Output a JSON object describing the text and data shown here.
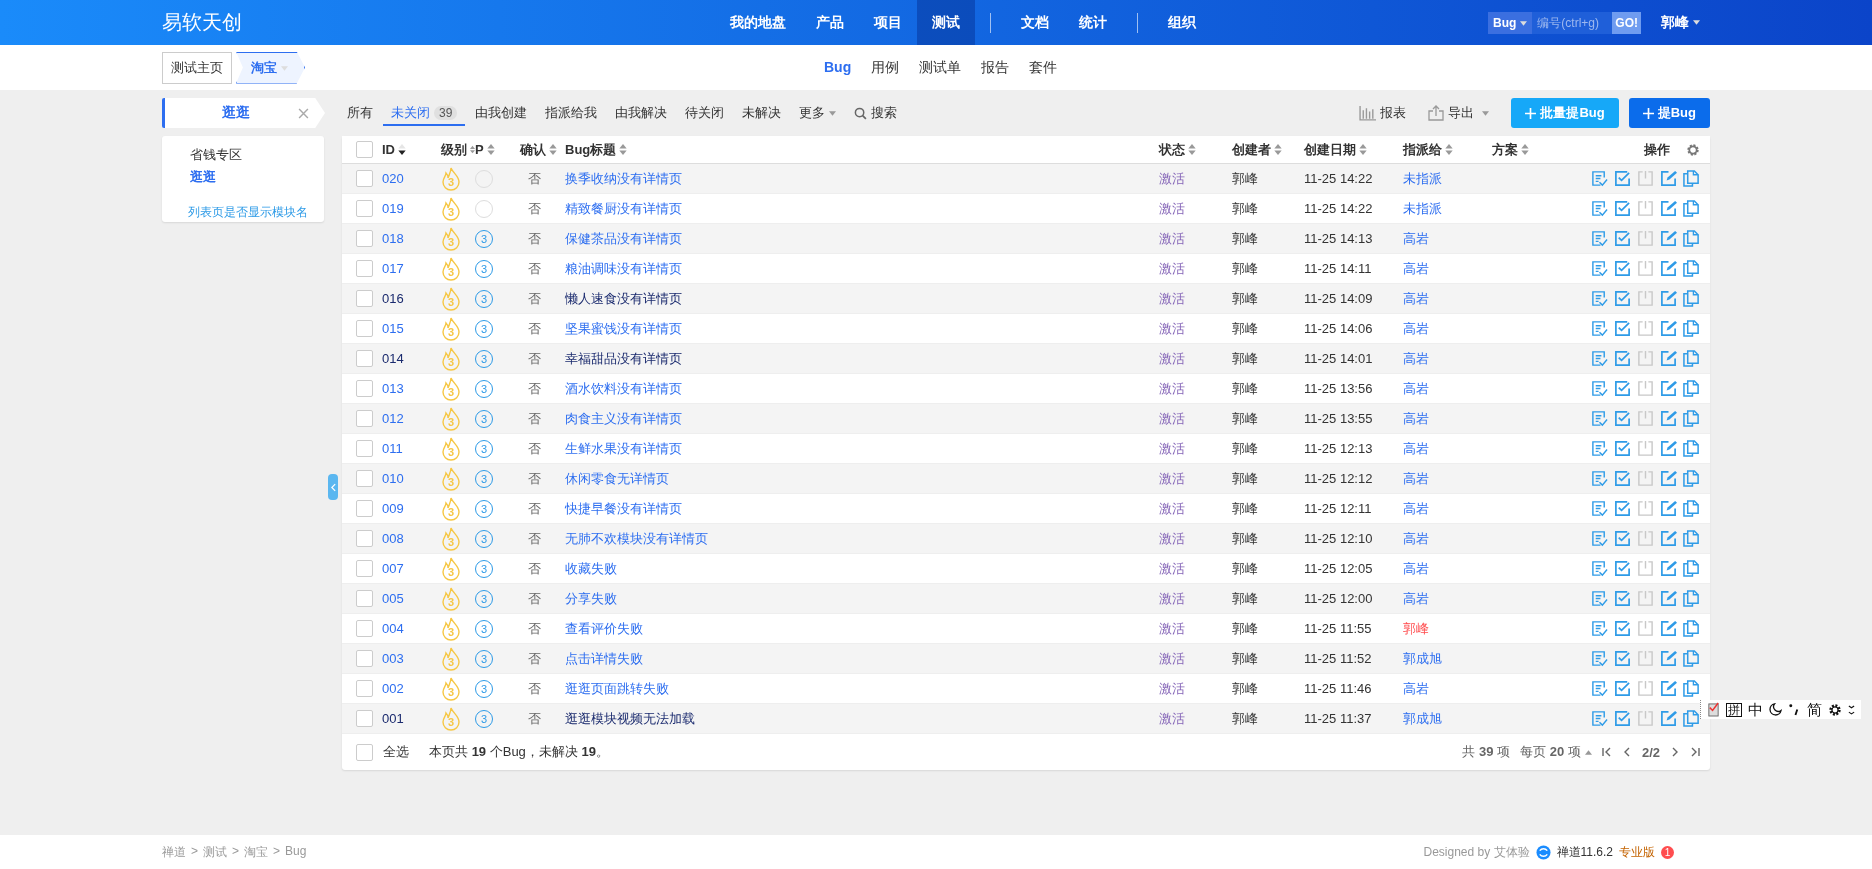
{
  "header": {
    "brand": "易软天创",
    "nav": [
      {
        "kind": "link",
        "label": "我的地盘",
        "selected": false
      },
      {
        "kind": "link",
        "label": "产品",
        "selected": false
      },
      {
        "kind": "link",
        "label": "项目",
        "selected": false
      },
      {
        "kind": "link",
        "label": "测试",
        "selected": true
      },
      {
        "kind": "divider"
      },
      {
        "kind": "link",
        "label": "文档",
        "selected": false
      },
      {
        "kind": "link",
        "label": "统计",
        "selected": false
      },
      {
        "kind": "divider"
      },
      {
        "kind": "link",
        "label": "组织",
        "selected": false
      }
    ],
    "search": {
      "type": "Bug",
      "placeholder": "编号(ctrl+g)",
      "button": "GO!"
    },
    "user": "郭峰"
  },
  "subnav": {
    "breadcrumb": [
      {
        "label": "测试主页",
        "dropdown": false
      },
      {
        "label": "淘宝",
        "dropdown": true
      }
    ],
    "tabs": [
      {
        "label": "Bug",
        "selected": true
      },
      {
        "label": "用例",
        "selected": false
      },
      {
        "label": "测试单",
        "selected": false
      },
      {
        "label": "报告",
        "selected": false
      },
      {
        "label": "套件",
        "selected": false
      }
    ]
  },
  "sidebar": {
    "title": "逛逛",
    "items": [
      {
        "label": "省钱专区",
        "selected": false
      },
      {
        "label": "逛逛",
        "selected": true
      }
    ],
    "link": "列表页是否显示模块名"
  },
  "filters": [
    {
      "kind": "tab",
      "label": "所有",
      "selected": false
    },
    {
      "kind": "tab",
      "label": "未关闭",
      "count": "39",
      "selected": true
    },
    {
      "kind": "tab",
      "label": "由我创建",
      "selected": false
    },
    {
      "kind": "tab",
      "label": "指派给我",
      "selected": false
    },
    {
      "kind": "tab",
      "label": "由我解决",
      "selected": false
    },
    {
      "kind": "tab",
      "label": "待关闭",
      "selected": false
    },
    {
      "kind": "tab",
      "label": "未解决",
      "selected": false
    },
    {
      "kind": "dropdown",
      "label": "更多",
      "selected": false
    },
    {
      "kind": "search",
      "label": "搜索",
      "selected": false
    }
  ],
  "actions": [
    {
      "kind": "report",
      "label": "报表"
    },
    {
      "kind": "export",
      "label": "导出"
    },
    {
      "kind": "batch",
      "label": "批量提Bug"
    },
    {
      "kind": "primary",
      "label": "提Bug"
    }
  ],
  "table": {
    "header_checked": false,
    "footer_checked": false,
    "columns": [
      {
        "label": "ID",
        "sorted": true
      },
      {
        "label": "级别",
        "sorted": false
      },
      {
        "label": "P",
        "sorted": false
      },
      {
        "label": "确认",
        "sorted": false
      },
      {
        "label": "Bug标题",
        "sorted": false
      },
      {
        "label": "状态",
        "sorted": false
      },
      {
        "label": "创建者",
        "sorted": false
      },
      {
        "label": "创建日期",
        "sorted": false
      },
      {
        "label": "指派给",
        "sorted": false
      },
      {
        "label": "方案",
        "sorted": false
      },
      {
        "label": "操作"
      }
    ],
    "rows": [
      {
        "id": "020",
        "checked": false,
        "severity": "3",
        "confirmed": "否",
        "title": "换季收纳没有详情页",
        "visited": false,
        "status": "激活",
        "creator": "郭峰",
        "date": "11-25 14:22",
        "assignee": "未指派",
        "mine": false
      },
      {
        "id": "019",
        "checked": false,
        "severity": "3",
        "confirmed": "否",
        "title": "精致餐厨没有详情页",
        "visited": false,
        "status": "激活",
        "creator": "郭峰",
        "date": "11-25 14:22",
        "assignee": "未指派",
        "mine": false
      },
      {
        "id": "018",
        "checked": false,
        "severity": "3",
        "priority": "3",
        "confirmed": "否",
        "title": "保健茶品没有详情页",
        "visited": false,
        "status": "激活",
        "creator": "郭峰",
        "date": "11-25 14:13",
        "assignee": "高岩",
        "mine": false
      },
      {
        "id": "017",
        "checked": false,
        "severity": "3",
        "priority": "3",
        "confirmed": "否",
        "title": "粮油调味没有详情页",
        "visited": false,
        "status": "激活",
        "creator": "郭峰",
        "date": "11-25 14:11",
        "assignee": "高岩",
        "mine": false
      },
      {
        "id": "016",
        "checked": false,
        "severity": "3",
        "priority": "3",
        "confirmed": "否",
        "title": "懒人速食没有详情页",
        "visited": true,
        "status": "激活",
        "creator": "郭峰",
        "date": "11-25 14:09",
        "assignee": "高岩",
        "mine": false
      },
      {
        "id": "015",
        "checked": false,
        "severity": "3",
        "priority": "3",
        "confirmed": "否",
        "title": "坚果蜜饯没有详情页",
        "visited": false,
        "status": "激活",
        "creator": "郭峰",
        "date": "11-25 14:06",
        "assignee": "高岩",
        "mine": false
      },
      {
        "id": "014",
        "checked": false,
        "severity": "3",
        "priority": "3",
        "confirmed": "否",
        "title": "幸福甜品没有详情页",
        "visited": true,
        "status": "激活",
        "creator": "郭峰",
        "date": "11-25 14:01",
        "assignee": "高岩",
        "mine": false
      },
      {
        "id": "013",
        "checked": false,
        "severity": "3",
        "priority": "3",
        "confirmed": "否",
        "title": "酒水饮料没有详情页",
        "visited": false,
        "status": "激活",
        "creator": "郭峰",
        "date": "11-25 13:56",
        "assignee": "高岩",
        "mine": false
      },
      {
        "id": "012",
        "checked": false,
        "severity": "3",
        "priority": "3",
        "confirmed": "否",
        "title": "肉食主义没有详情页",
        "visited": false,
        "status": "激活",
        "creator": "郭峰",
        "date": "11-25 13:55",
        "assignee": "高岩",
        "mine": false
      },
      {
        "id": "011",
        "checked": false,
        "severity": "3",
        "priority": "3",
        "confirmed": "否",
        "title": "生鲜水果没有详情页",
        "visited": false,
        "status": "激活",
        "creator": "郭峰",
        "date": "11-25 12:13",
        "assignee": "高岩",
        "mine": false
      },
      {
        "id": "010",
        "checked": false,
        "severity": "3",
        "priority": "3",
        "confirmed": "否",
        "title": "休闲零食无详情页",
        "visited": false,
        "status": "激活",
        "creator": "郭峰",
        "date": "11-25 12:12",
        "assignee": "高岩",
        "mine": false
      },
      {
        "id": "009",
        "checked": false,
        "severity": "3",
        "priority": "3",
        "confirmed": "否",
        "title": "快捷早餐没有详情页",
        "visited": false,
        "status": "激活",
        "creator": "郭峰",
        "date": "11-25 12:11",
        "assignee": "高岩",
        "mine": false
      },
      {
        "id": "008",
        "checked": false,
        "severity": "3",
        "priority": "3",
        "confirmed": "否",
        "title": "无肺不欢模块没有详情页",
        "visited": false,
        "status": "激活",
        "creator": "郭峰",
        "date": "11-25 12:10",
        "assignee": "高岩",
        "mine": false
      },
      {
        "id": "007",
        "checked": false,
        "severity": "3",
        "priority": "3",
        "confirmed": "否",
        "title": "收藏失败",
        "visited": false,
        "status": "激活",
        "creator": "郭峰",
        "date": "11-25 12:05",
        "assignee": "高岩",
        "mine": false
      },
      {
        "id": "005",
        "checked": false,
        "severity": "3",
        "priority": "3",
        "confirmed": "否",
        "title": "分享失败",
        "visited": false,
        "status": "激活",
        "creator": "郭峰",
        "date": "11-25 12:00",
        "assignee": "高岩",
        "mine": false
      },
      {
        "id": "004",
        "checked": false,
        "severity": "3",
        "priority": "3",
        "confirmed": "否",
        "title": "查看评价失败",
        "visited": false,
        "status": "激活",
        "creator": "郭峰",
        "date": "11-25 11:55",
        "assignee": "郭峰",
        "mine": true
      },
      {
        "id": "003",
        "checked": false,
        "severity": "3",
        "priority": "3",
        "confirmed": "否",
        "title": "点击详情失败",
        "visited": false,
        "status": "激活",
        "creator": "郭峰",
        "date": "11-25 11:52",
        "assignee": "郭成旭",
        "mine": false
      },
      {
        "id": "002",
        "checked": false,
        "severity": "3",
        "priority": "3",
        "confirmed": "否",
        "title": "逛逛页面跳转失败",
        "visited": false,
        "status": "激活",
        "creator": "郭峰",
        "date": "11-25 11:46",
        "assignee": "高岩",
        "mine": false
      },
      {
        "id": "001",
        "checked": false,
        "severity": "3",
        "priority": "3",
        "confirmed": "否",
        "title": "逛逛模块视频无法加载",
        "visited": true,
        "status": "激活",
        "creator": "郭峰",
        "date": "11-25 11:37",
        "assignee": "郭成旭",
        "mine": false
      }
    ],
    "select_all": "全选",
    "summary": "本页共 **19** 个Bug，未解决 **19**。",
    "pager": {
      "total": "共 **39** 项",
      "per_page": "每页 **20** 项",
      "page": "2/2"
    }
  },
  "ime": [
    "拼",
    "中",
    "简"
  ],
  "footer": {
    "breadcrumb": [
      "禅道",
      "测试",
      "淘宝",
      "Bug"
    ],
    "separator": ">",
    "designed": "Designed by 艾体验",
    "version": "禅道11.6.2",
    "edition": "专业版",
    "badge": "1"
  }
}
